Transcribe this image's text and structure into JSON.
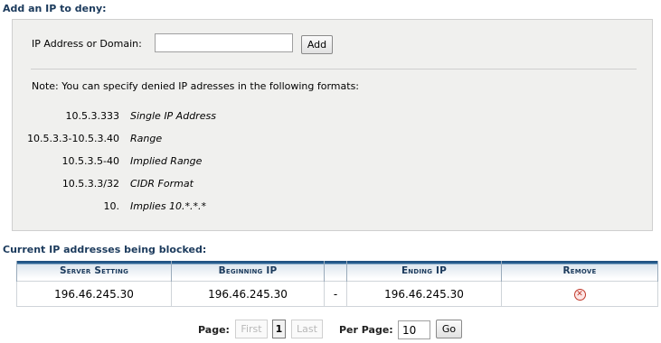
{
  "deny": {
    "title": "Add an IP to deny:",
    "ip_label": "IP Address or Domain:",
    "ip_value": "",
    "ip_placeholder": "",
    "add_label": "Add",
    "note": "Note: You can specify denied IP adresses in the following formats:",
    "formats": [
      {
        "example": "10.5.3.333",
        "desc": "Single IP Address"
      },
      {
        "example": "10.5.3.3-10.5.3.40",
        "desc": "Range"
      },
      {
        "example": "10.5.3.5-40",
        "desc": "Implied Range"
      },
      {
        "example": "10.5.3.3/32",
        "desc": "CIDR Format"
      },
      {
        "example": "10.",
        "desc": "Implies 10.*.*.*"
      }
    ]
  },
  "blocked": {
    "title": "Current IP addresses being blocked:",
    "columns": [
      "Server Setting",
      "Beginning IP",
      "",
      "Ending IP",
      "Remove"
    ],
    "rows": [
      {
        "server_setting": "196.46.245.30",
        "beginning_ip": "196.46.245.30",
        "separator": "-",
        "ending_ip": "196.46.245.30",
        "remove_icon": "remove-circle-icon"
      }
    ]
  },
  "pager": {
    "page_label": "Page:",
    "first_label": "First",
    "current_page": "1",
    "last_label": "Last",
    "per_page_label": "Per Page:",
    "per_page_value": "10",
    "go_label": "Go"
  },
  "colors": {
    "title": "#1b3a5c",
    "header_bar": "#2a6496",
    "remove_icon": "#c0392b"
  }
}
